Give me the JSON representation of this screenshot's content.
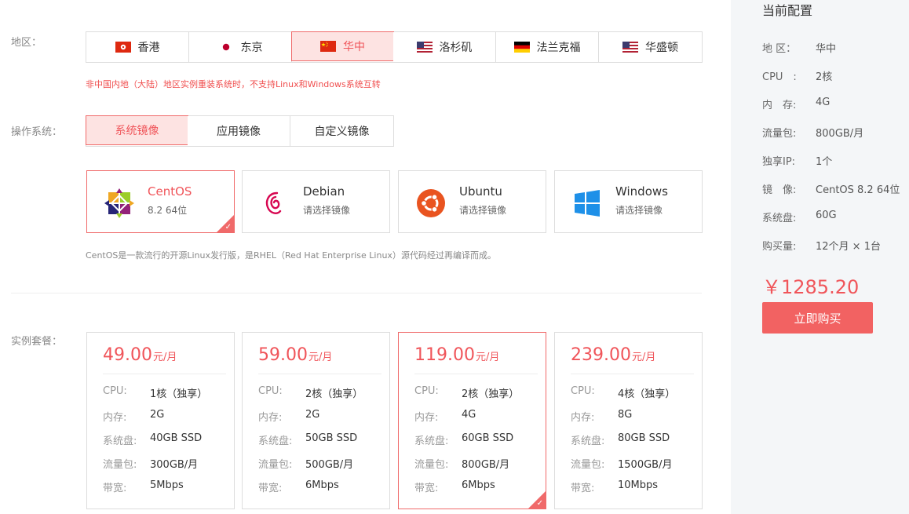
{
  "region": {
    "label": "地区：",
    "items": [
      {
        "name": "香港",
        "flag": "hk-flag-icon"
      },
      {
        "name": "东京",
        "flag": "jp-flag-icon"
      },
      {
        "name": "华中",
        "flag": "cn-flag-icon",
        "active": true
      },
      {
        "name": "洛杉矶",
        "flag": "us-flag-icon"
      },
      {
        "name": "法兰克福",
        "flag": "de-flag-icon"
      },
      {
        "name": "华盛顿",
        "flag": "us-flag-icon"
      }
    ],
    "warning": "非中国内地（大陆）地区实例重装系统时，不支持Linux和Windows系统互转"
  },
  "os": {
    "label": "操作系统：",
    "tabs": [
      {
        "label": "系统镜像",
        "active": true
      },
      {
        "label": "应用镜像"
      },
      {
        "label": "自定义镜像"
      }
    ],
    "cards": [
      {
        "name": "CentOS",
        "sub": "8.2 64位",
        "icon": "centos-logo-icon",
        "active": true
      },
      {
        "name": "Debian",
        "sub": "请选择镜像",
        "icon": "debian-logo-icon"
      },
      {
        "name": "Ubuntu",
        "sub": "请选择镜像",
        "icon": "ubuntu-logo-icon"
      },
      {
        "name": "Windows",
        "sub": "请选择镜像",
        "icon": "windows-logo-icon"
      }
    ],
    "description": "CentOS是一款流行的开源Linux发行版，是RHEL（Red Hat Enterprise Linux）源代码经过再编译而成。"
  },
  "plans": {
    "label": "实例套餐：",
    "spec_labels": {
      "cpu": "CPU:",
      "mem": "内存:",
      "disk": "系统盘:",
      "traffic": "流量包:",
      "bw": "带宽:"
    },
    "unit": "元/月",
    "items": [
      {
        "price": "49.00",
        "cpu": "1核（独享）",
        "mem": "2G",
        "disk": "40GB SSD",
        "traffic": "300GB/月",
        "bw": "5Mbps"
      },
      {
        "price": "59.00",
        "cpu": "2核（独享）",
        "mem": "2G",
        "disk": "50GB SSD",
        "traffic": "500GB/月",
        "bw": "6Mbps"
      },
      {
        "price": "119.00",
        "cpu": "2核（独享）",
        "mem": "4G",
        "disk": "60GB SSD",
        "traffic": "800GB/月",
        "bw": "6Mbps",
        "active": true
      },
      {
        "price": "239.00",
        "cpu": "4核（独享）",
        "mem": "8G",
        "disk": "80GB SSD",
        "traffic": "1500GB/月",
        "bw": "10Mbps"
      }
    ]
  },
  "summary": {
    "title": "当前配置",
    "rows": [
      {
        "k": "地 区：",
        "v": "华中"
      },
      {
        "k": "CPU　:",
        "v": "2核"
      },
      {
        "k": "内　存:",
        "v": "4G"
      },
      {
        "k": "流量包:",
        "v": "800GB/月"
      },
      {
        "k": "独享IP:",
        "v": "1个"
      },
      {
        "k": "镜　像:",
        "v": "CentOS 8.2 64位"
      },
      {
        "k": "系统盘:",
        "v": "60G"
      },
      {
        "k": "购买量:",
        "v": "12个月 × 1台"
      }
    ],
    "total": "￥1285.20",
    "buy_label": "立即购买"
  },
  "colors": {
    "accent": "#f0555a",
    "accent_bg": "#fde3e2",
    "buy": "#f26262",
    "side_bg": "#f4f6f8"
  }
}
